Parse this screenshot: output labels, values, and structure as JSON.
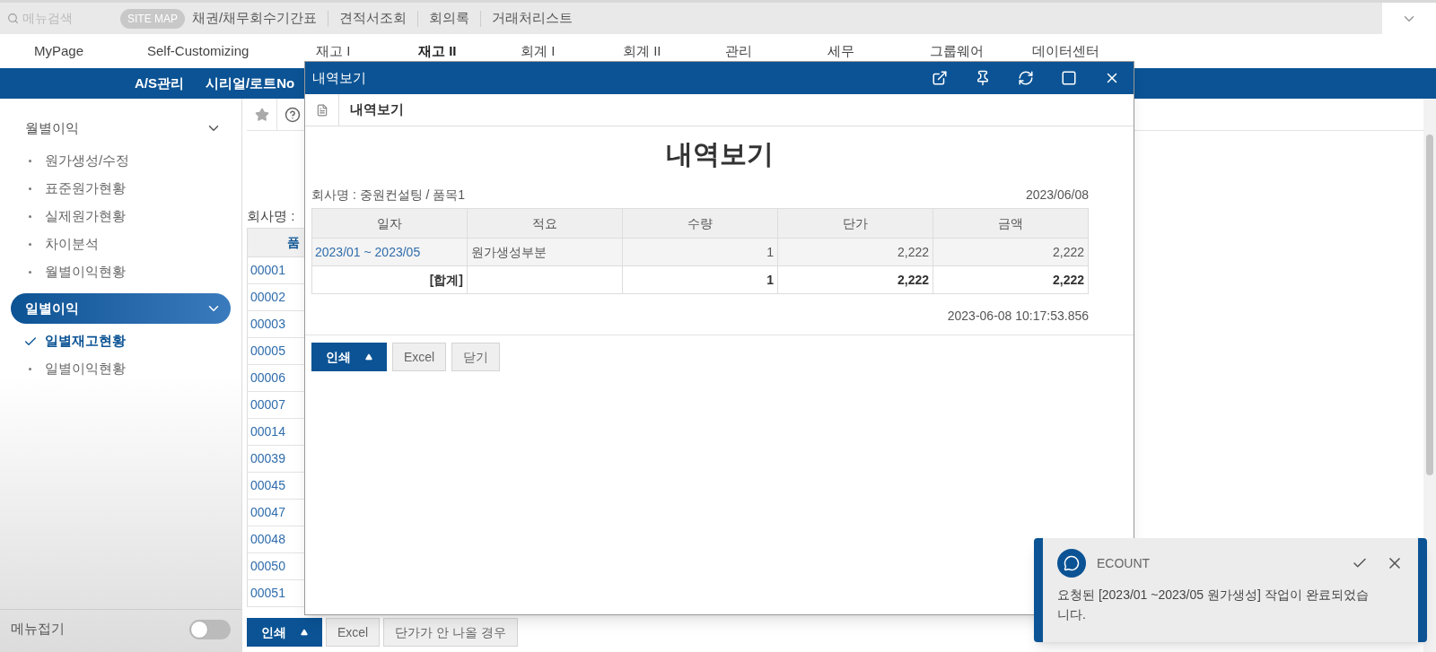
{
  "search": {
    "placeholder": "메뉴검색"
  },
  "site_map": "SITE MAP",
  "quick_links": [
    "채권/채무회수기간표",
    "견적서조회",
    "회의록",
    "거래처리스트"
  ],
  "top_menu": [
    {
      "label": "MyPage",
      "selected": false
    },
    {
      "label": "Self-Customizing",
      "selected": false
    },
    {
      "label": "재고 I",
      "selected": false
    },
    {
      "label": "재고 II",
      "selected": true
    },
    {
      "label": "회계 I",
      "selected": false
    },
    {
      "label": "회계 II",
      "selected": false
    },
    {
      "label": "관리",
      "selected": false
    },
    {
      "label": "세무",
      "selected": false
    },
    {
      "label": "그룹웨어",
      "selected": false
    },
    {
      "label": "데이터센터",
      "selected": false
    }
  ],
  "sub_menu": [
    "A/S관리",
    "시리얼/로트No"
  ],
  "sidebar": {
    "groups": [
      {
        "label": "월별이익",
        "selected": false,
        "children": [
          {
            "label": "원가생성/수정",
            "selected": false
          },
          {
            "label": "표준원가현황",
            "selected": false
          },
          {
            "label": "실제원가현황",
            "selected": false
          },
          {
            "label": "차이분석",
            "selected": false
          },
          {
            "label": "월별이익현황",
            "selected": false
          }
        ]
      },
      {
        "label": "일별이익",
        "selected": true,
        "children": [
          {
            "label": "일별재고현황",
            "selected": true
          },
          {
            "label": "일별이익현황",
            "selected": false
          }
        ]
      }
    ],
    "collapse": {
      "label": "메뉴접기",
      "on": false
    }
  },
  "content": {
    "company_label": "회사명 :",
    "column_1": "품",
    "rows": [
      "00001",
      "00002",
      "00003",
      "00005",
      "00006",
      "00007",
      "00014",
      "00039",
      "00045",
      "00047",
      "00048",
      "00050",
      "00051"
    ],
    "buttons": [
      {
        "label": "인쇄",
        "kind": "primary"
      },
      {
        "label": "Excel",
        "kind": "default"
      },
      {
        "label": "단가가 안 나올 경우",
        "kind": "default"
      }
    ]
  },
  "dialog": {
    "title": "내역보기",
    "tab": "내역보기",
    "heading": "내역보기",
    "company": "회사명 : 중원컨설팅 / 품목1",
    "date": "2023/06/08",
    "columns": [
      "일자",
      "적요",
      "수량",
      "단가",
      "금액"
    ],
    "rows": [
      [
        "2023/01 ~ 2023/05",
        "원가생성부분",
        "1",
        "2,222",
        "2,222"
      ]
    ],
    "total": {
      "label": "[합계]",
      "values": [
        "1",
        "2,222",
        "2,222"
      ]
    },
    "timestamp": "2023-06-08 10:17:53.856",
    "buttons": [
      {
        "label": "인쇄",
        "kind": "primary"
      },
      {
        "label": "Excel",
        "kind": "default"
      },
      {
        "label": "닫기",
        "kind": "default"
      }
    ]
  },
  "toast": {
    "title": "ECOUNT",
    "message": "요청된 [2023/01 ~2023/05 원가생성] 작업이 완료되었습니다."
  }
}
